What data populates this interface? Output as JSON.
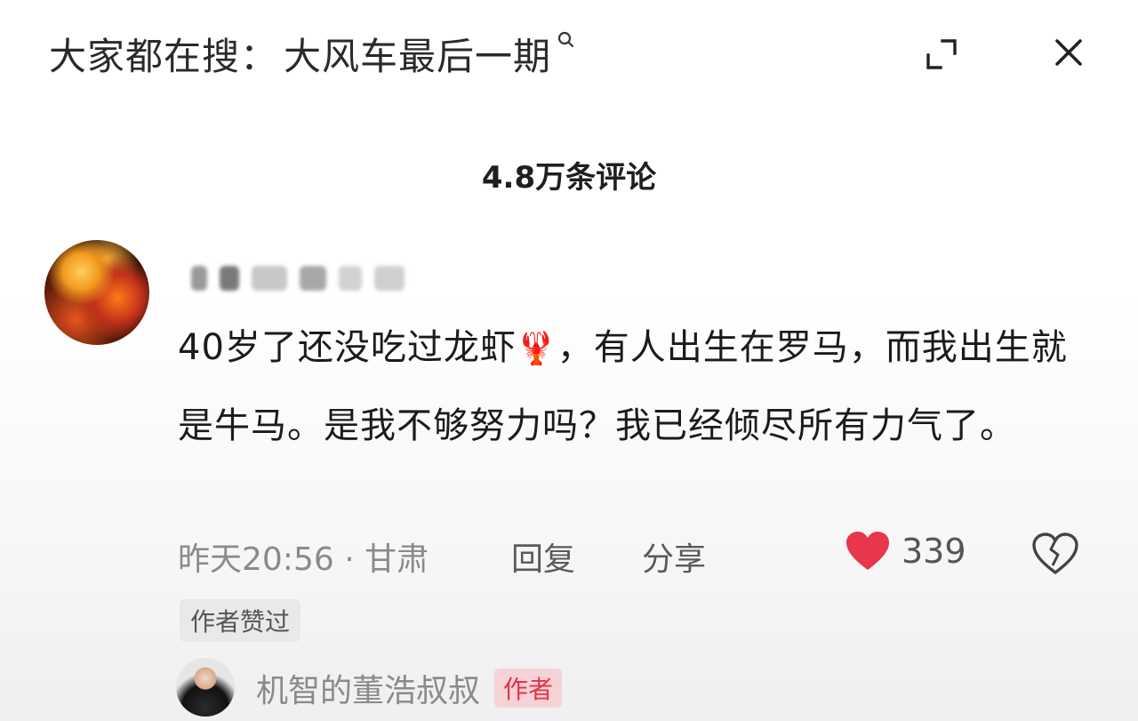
{
  "header": {
    "search_prefix": "大家都在搜：",
    "search_term": "大风车最后一期",
    "search_icon": "search-icon",
    "expand_icon": "expand-icon",
    "close_icon": "close-icon"
  },
  "comments": {
    "count_label": "4.8万条评论"
  },
  "comment": {
    "text_before_emoji": "40岁了还没吃过龙虾",
    "emoji": "🦞",
    "text_after_emoji": "，有人出生在罗马，而我出生就是牛马。是我不够努力吗？我已经倾尽所有力气了。",
    "time_location": "昨天20:56 · 甘肃",
    "reply_label": "回复",
    "share_label": "分享",
    "like_count": "339",
    "author_liked_badge": "作者赞过",
    "like_color": "#e8364a"
  },
  "reply": {
    "author_name": "机智的董浩叔叔",
    "author_tag": "作者",
    "tag_color": "#e3324a"
  }
}
